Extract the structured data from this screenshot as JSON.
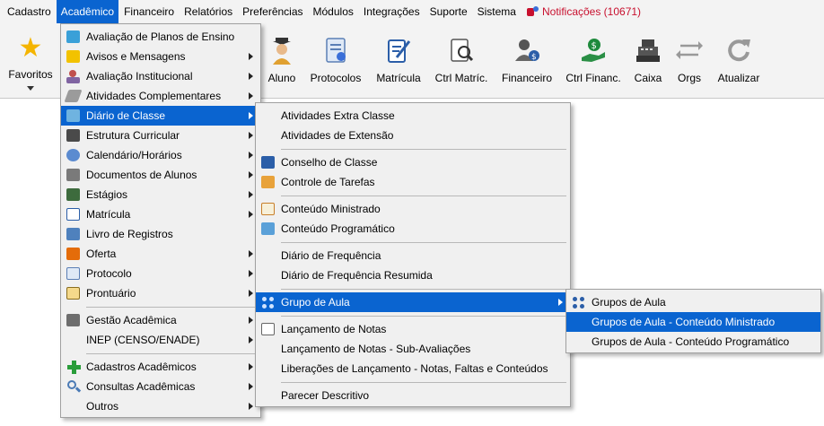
{
  "menubar": {
    "items": [
      "Cadastro",
      "Acadêmico",
      "Financeiro",
      "Relatórios",
      "Preferências",
      "Módulos",
      "Integrações",
      "Suporte",
      "Sistema"
    ],
    "notifications": "Notificações (10671)"
  },
  "toolbar": {
    "favorites": "Favoritos",
    "buttons": [
      "Aluno",
      "Protocolos",
      "Matrícula",
      "Ctrl Matríc.",
      "Financeiro",
      "Ctrl Financ.",
      "Caixa",
      "Orgs",
      "Atualizar"
    ]
  },
  "menu_academico": {
    "items": [
      "Avaliação de Planos de Ensino",
      "Avisos e Mensagens",
      "Avaliação Institucional",
      "Atividades Complementares",
      "Diário de Classe",
      "Estrutura Curricular",
      "Calendário/Horários",
      "Documentos de Alunos",
      "Estágios",
      "Matrícula",
      "Livro de Registros",
      "Oferta",
      "Protocolo",
      "Prontuário",
      "Gestão Acadêmica",
      "INEP (CENSO/ENADE)",
      "Cadastros Acadêmicos",
      "Consultas Acadêmicas",
      "Outros"
    ]
  },
  "menu_diario": {
    "items": [
      "Atividades Extra Classe",
      "Atividades de Extensão",
      "Conselho de Classe",
      "Controle de Tarefas",
      "Conteúdo Ministrado",
      "Conteúdo Programático",
      "Diário de Frequência",
      "Diário de Frequência Resumida",
      "Grupo de Aula",
      "Lançamento de Notas",
      "Lançamento de Notas - Sub-Avaliações",
      "Liberações de Lançamento - Notas, Faltas e Conteúdos",
      "Parecer Descritivo"
    ]
  },
  "menu_grupo": {
    "items": [
      "Grupos de Aula",
      "Grupos de Aula - Conteúdo Ministrado",
      "Grupos de Aula - Conteúdo Programático"
    ]
  },
  "colors": {
    "highlight": "#0a64d0",
    "notification": "#c8102e",
    "star": "#f4b400"
  }
}
